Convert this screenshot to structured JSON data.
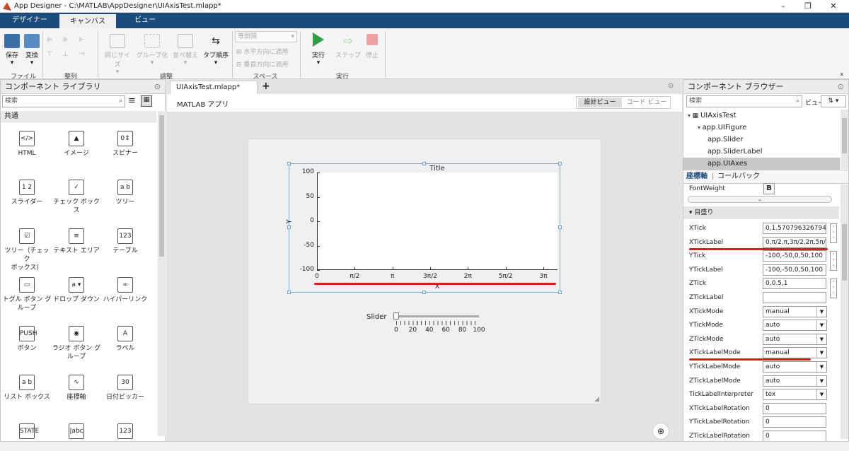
{
  "window": {
    "title": "App Designer - C:\\MATLAB\\AppDesigner\\UIAxisTest.mlapp*"
  },
  "ribbon_tabs": [
    {
      "label": "デザイナー"
    },
    {
      "label": "キャンバス"
    },
    {
      "label": "ビュー"
    }
  ],
  "ribbon": {
    "file": {
      "save": "保存",
      "convert": "変換",
      "group": "ファイル"
    },
    "align": {
      "group": "整列"
    },
    "arrange": {
      "same_size": "同じサイズ",
      "group_btn": "グループ化",
      "reorder": "並べ替え",
      "tab_order": "タブ順序",
      "group": "調整"
    },
    "space": {
      "select": "等間隔",
      "horizontal": "水平方向に適用",
      "vertical": "垂直方向に適用",
      "group": "スペース"
    },
    "run": {
      "run": "実行",
      "step": "ステップ",
      "stop": "停止",
      "group": "実行"
    }
  },
  "library": {
    "title": "コンポーネント ライブラリ",
    "search_placeholder": "検索",
    "section": "共通",
    "items": [
      {
        "label": "HTML",
        "icon": "html-icon",
        "glyph": "</>"
      },
      {
        "label": "イメージ",
        "icon": "image-icon",
        "glyph": "▲"
      },
      {
        "label": "スピナー",
        "icon": "spinner-icon",
        "glyph": "0⇕"
      },
      {
        "label": "スライダー",
        "icon": "slider-icon",
        "glyph": "1 2"
      },
      {
        "label": "チェック ボックス",
        "icon": "checkbox-icon",
        "glyph": "✓"
      },
      {
        "label": "ツリー",
        "icon": "tree-icon",
        "glyph": "a b"
      },
      {
        "label": "ツリー（チェック\nボックス）",
        "icon": "checkbox-tree-icon",
        "glyph": "☑"
      },
      {
        "label": "テキスト エリア",
        "icon": "text-area-icon",
        "glyph": "≡"
      },
      {
        "label": "テーブル",
        "icon": "table-icon",
        "glyph": "123"
      },
      {
        "label": "トグル ボタン グ\nループ",
        "icon": "toggle-button-group-icon",
        "glyph": "▭"
      },
      {
        "label": "ドロップ ダウン",
        "icon": "dropdown-icon",
        "glyph": "a ▾"
      },
      {
        "label": "ハイパーリンク",
        "icon": "hyperlink-icon",
        "glyph": "∞"
      },
      {
        "label": "ボタン",
        "icon": "button-icon",
        "glyph": "PUSH"
      },
      {
        "label": "ラジオ ボタン グ\nループ",
        "icon": "radio-group-icon",
        "glyph": "◉"
      },
      {
        "label": "ラベル",
        "icon": "label-icon",
        "glyph": "A"
      },
      {
        "label": "リスト ボックス",
        "icon": "listbox-icon",
        "glyph": "a b"
      },
      {
        "label": "座標軸",
        "icon": "axes-icon",
        "glyph": "∿"
      },
      {
        "label": "日付ピッカー",
        "icon": "date-picker-icon",
        "glyph": "30"
      },
      {
        "label": "",
        "icon": "state-button-icon",
        "glyph": "STATE"
      },
      {
        "label": "",
        "icon": "edit-field-text-icon",
        "glyph": "|abc"
      },
      {
        "label": "",
        "icon": "edit-field-numeric-icon",
        "glyph": "123"
      }
    ]
  },
  "document": {
    "tab": "UIAxisTest.mlapp*",
    "subtitle": "MATLAB アプリ",
    "view_design": "設計ビュー",
    "view_code": "コード ビュー"
  },
  "axes": {
    "title": "Title",
    "xlabel": "X",
    "ylabel": "Y",
    "yticks": [
      "100",
      "50",
      "0",
      "-50",
      "-100"
    ],
    "xticks": [
      "0",
      "π/2",
      "π",
      "3π/2",
      "2π",
      "5π/2",
      "3π"
    ]
  },
  "slider": {
    "label": "Slider",
    "ticks": [
      "0",
      "20",
      "40",
      "60",
      "80",
      "100"
    ],
    "value": 0
  },
  "browser": {
    "title": "コンポーネント ブラウザー",
    "search_placeholder": "検索",
    "view_label": "ビュー",
    "tree": [
      {
        "label": "UIAxisTest",
        "level": 0
      },
      {
        "label": "app.UIFigure",
        "level": 1
      },
      {
        "label": "app.Slider",
        "level": 2
      },
      {
        "label": "app.SliderLabel",
        "level": 2
      },
      {
        "label": "app.UIAxes",
        "level": 2,
        "selected": true
      }
    ],
    "tab_axes": "座標軸",
    "tab_callback": "コールバック"
  },
  "properties": {
    "fontweight_label": "FontWeight",
    "fontweight_value": "B",
    "section": "目盛り",
    "rows": [
      {
        "name": "XTick",
        "value": "0,1.5707963267948",
        "kind": "text",
        "ellipsis": true
      },
      {
        "name": "XTickLabel",
        "value": "0,π/2,π,3π/2,2π,5π/",
        "kind": "text",
        "underline": true
      },
      {
        "name": "YTick",
        "value": "-100,-50,0,50,100",
        "kind": "text",
        "ellipsis": true
      },
      {
        "name": "YTickLabel",
        "value": "-100,-50,0,50,100",
        "kind": "text"
      },
      {
        "name": "ZTick",
        "value": "0,0.5,1",
        "kind": "text",
        "ellipsis": true
      },
      {
        "name": "ZTickLabel",
        "value": "",
        "kind": "text"
      },
      {
        "name": "XTickMode",
        "value": "manual",
        "kind": "dropdown"
      },
      {
        "name": "YTickMode",
        "value": "auto",
        "kind": "dropdown"
      },
      {
        "name": "ZTickMode",
        "value": "auto",
        "kind": "dropdown"
      },
      {
        "name": "XTickLabelMode",
        "value": "manual",
        "kind": "dropdown",
        "underline": true
      },
      {
        "name": "YTickLabelMode",
        "value": "auto",
        "kind": "dropdown"
      },
      {
        "name": "ZTickLabelMode",
        "value": "auto",
        "kind": "dropdown"
      },
      {
        "name": "TickLabelInterpreter",
        "value": "tex",
        "kind": "dropdown"
      },
      {
        "name": "XTickLabelRotation",
        "value": "0",
        "kind": "text"
      },
      {
        "name": "YTickLabelRotation",
        "value": "0",
        "kind": "text"
      },
      {
        "name": "ZTickLabelRotation",
        "value": "0",
        "kind": "text"
      }
    ]
  },
  "colors": {
    "ribbon_blue": "#1b4b7a",
    "highlight_red": "#d42020",
    "selection": "#c7c7c7",
    "run_green": "#2ea043"
  }
}
